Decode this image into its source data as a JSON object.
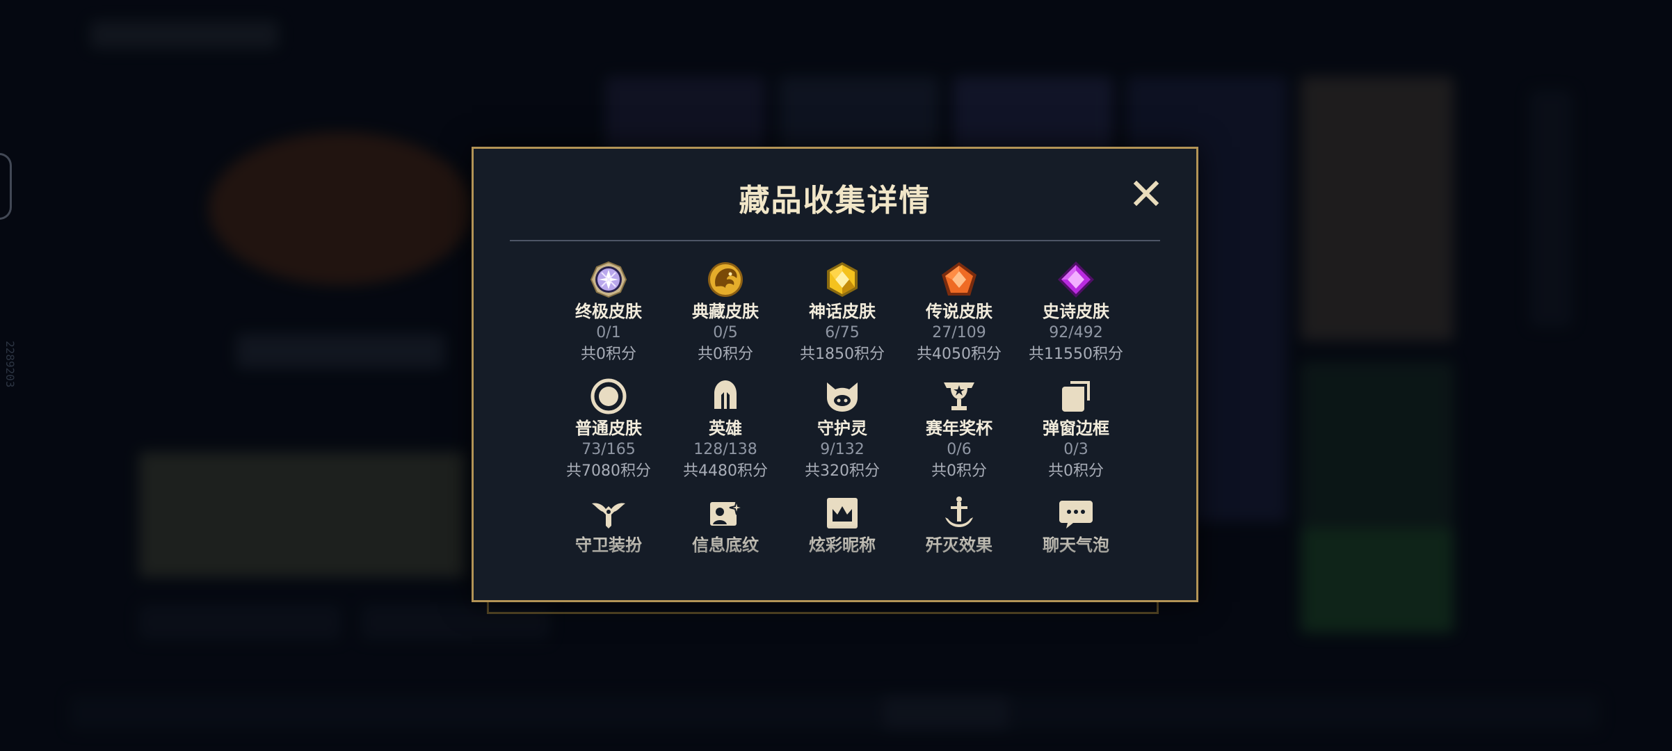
{
  "side_id": "2289203",
  "modal": {
    "title": "藏品收集详情"
  },
  "colors": {
    "gold_border": "#b39456",
    "modal_bg": "#151c27",
    "title_text": "#f1e6c8"
  },
  "items": [
    {
      "name": "终极皮肤",
      "count": "0/1",
      "points": "共0积分",
      "icon": "ultimate-gem-icon"
    },
    {
      "name": "典藏皮肤",
      "count": "0/5",
      "points": "共0积分",
      "icon": "dragon-emblem-icon"
    },
    {
      "name": "神话皮肤",
      "count": "6/75",
      "points": "共1850积分",
      "icon": "mythic-hexagon-icon"
    },
    {
      "name": "传说皮肤",
      "count": "27/109",
      "points": "共4050积分",
      "icon": "legendary-pentagon-icon"
    },
    {
      "name": "史诗皮肤",
      "count": "92/492",
      "points": "共11550积分",
      "icon": "epic-diamond-icon"
    },
    {
      "name": "普通皮肤",
      "count": "73/165",
      "points": "共7080积分",
      "icon": "normal-circle-icon"
    },
    {
      "name": "英雄",
      "count": "128/138",
      "points": "共4480积分",
      "icon": "helmet-icon"
    },
    {
      "name": "守护灵",
      "count": "9/132",
      "points": "共320积分",
      "icon": "guardian-pet-icon"
    },
    {
      "name": "赛年奖杯",
      "count": "0/6",
      "points": "共0积分",
      "icon": "trophy-icon"
    },
    {
      "name": "弹窗边框",
      "count": "0/3",
      "points": "共0积分",
      "icon": "frame-stack-icon"
    },
    {
      "name": "守卫装扮",
      "count": "",
      "points": "",
      "icon": "ward-icon"
    },
    {
      "name": "信息底纹",
      "count": "",
      "points": "",
      "icon": "card-sparkle-icon"
    },
    {
      "name": "炫彩昵称",
      "count": "",
      "points": "",
      "icon": "crown-name-icon"
    },
    {
      "name": "歼灭效果",
      "count": "",
      "points": "",
      "icon": "sword-icon"
    },
    {
      "name": "聊天气泡",
      "count": "",
      "points": "",
      "icon": "chat-bubble-icon"
    }
  ]
}
